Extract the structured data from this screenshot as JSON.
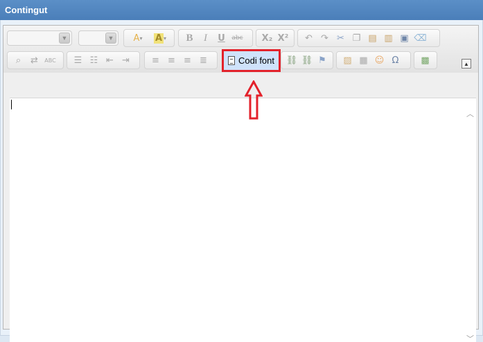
{
  "window": {
    "title": "Contingut"
  },
  "toolbar": {
    "row1": {
      "text_color_icon": "text-color-icon",
      "bg_color_icon": "background-color-icon",
      "bold": "B",
      "italic": "I",
      "underline": "U",
      "strike": "abc",
      "subscript": "X₂",
      "superscript": "X²"
    },
    "source_button_label": "Codi font"
  },
  "colors": {
    "title_bar": "#4a7eb9",
    "highlight_border": "#e3222b",
    "source_button_bg": "#cfe2fb"
  }
}
